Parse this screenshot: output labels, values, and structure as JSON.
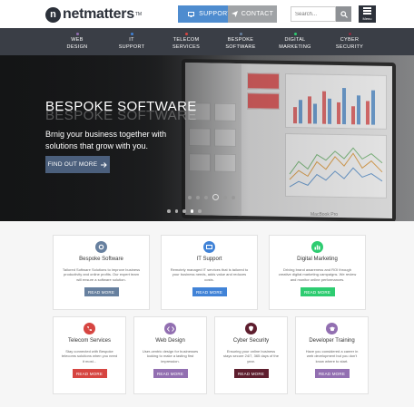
{
  "header": {
    "logo_mark": "n",
    "logo_text": "netmatters",
    "logo_tm": "TM",
    "support_label": "SUPPORT",
    "contact_label": "CONTACT",
    "search_placeholder": "Search...",
    "menu_label": "Menu"
  },
  "nav": {
    "items": [
      {
        "line1": "WEB",
        "line2": "DESIGN",
        "color": "#926fb1"
      },
      {
        "line1": "IT",
        "line2": "SUPPORT",
        "color": "#4183d7"
      },
      {
        "line1": "TELECOM",
        "line2": "SERVICES",
        "color": "#d64541"
      },
      {
        "line1": "BESPOKE",
        "line2": "SOFTWARE",
        "color": "#67809f"
      },
      {
        "line1": "DIGITAL",
        "line2": "MARKETING",
        "color": "#2ecc71"
      },
      {
        "line1": "CYBER",
        "line2": "SECURITY",
        "color": "#5e1e2e"
      }
    ]
  },
  "hero": {
    "title": "BESPOKE SOFTWARE",
    "title_echo": "BESPOKE SOFTWARE",
    "subtitle": "Brnig your business together with solutions that grow with you.",
    "button_label": "FIND OUT MORE",
    "laptop_label": "MacBook Pro"
  },
  "services": [
    {
      "title": "Bespoke Software",
      "desc": "Tailored Software Solutions to improve business productivity and online profits. Our expert team will ensure a software solution.",
      "color": "#67809f",
      "icon": "gear-icon"
    },
    {
      "title": "IT Support",
      "desc": "Remotely managed IT services that is tailored to your business needs, adds value and reduces costs.",
      "color": "#4183d7",
      "icon": "monitor-icon"
    },
    {
      "title": "Digital Marketing",
      "desc": "Driving brand awareness and ROI through creative digital marketing campaigns. We review and monitor online performances.",
      "color": "#2ecc71",
      "icon": "bar-chart-icon"
    },
    {
      "title": "Telecom Services",
      "desc": "Stay connected with Bespoke telecoms solutions when you need it most...",
      "color": "#d64541",
      "icon": "phone-icon"
    },
    {
      "title": "Web Design",
      "desc": "User-centric design for businesses looking to make a lasting first impression.",
      "color": "#926fb1",
      "icon": "code-icon"
    },
    {
      "title": "Cyber Security",
      "desc": "Ensuring your online business stays secure 24/7, 365 days of the year.",
      "color": "#5e1e2e",
      "icon": "shield-icon"
    },
    {
      "title": "Developer Training",
      "desc": "Have you considered a career in web development but you don't know where to start.",
      "color": "#926fb1",
      "icon": "graduation-cap-icon"
    }
  ],
  "read_more_label": "READ MORE"
}
